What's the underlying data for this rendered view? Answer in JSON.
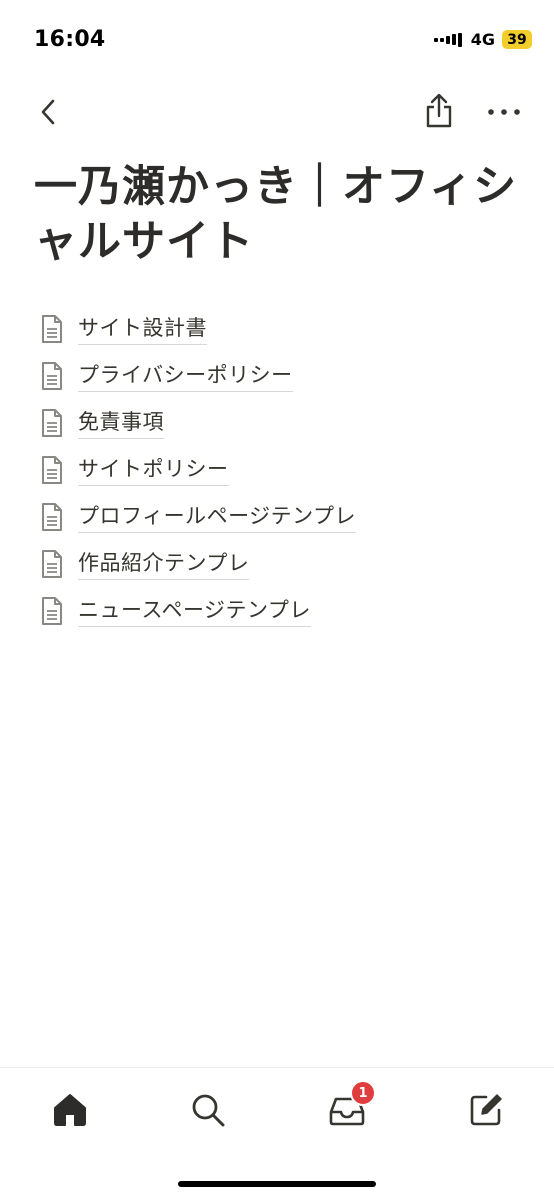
{
  "status_bar": {
    "time": "16:04",
    "network": "4G",
    "battery": "39",
    "battery_color": "#f2cd2b"
  },
  "nav": {
    "back_icon": "chevron-left-icon",
    "share_icon": "share-icon",
    "more_icon": "more-horizontal-icon"
  },
  "page": {
    "title": "一乃瀬かっき｜オフィシャルサイト",
    "items": [
      {
        "label": "サイト設計書",
        "icon": "page-icon"
      },
      {
        "label": "プライバシーポリシー",
        "icon": "page-icon"
      },
      {
        "label": "免責事項",
        "icon": "page-icon"
      },
      {
        "label": "サイトポリシー",
        "icon": "page-icon"
      },
      {
        "label": "プロフィールページテンプレ",
        "icon": "page-icon"
      },
      {
        "label": "作品紹介テンプレ",
        "icon": "page-icon"
      },
      {
        "label": "ニュースページテンプレ",
        "icon": "page-icon"
      }
    ]
  },
  "tab_bar": {
    "tabs": [
      {
        "name": "home",
        "icon": "home-icon"
      },
      {
        "name": "search",
        "icon": "search-icon"
      },
      {
        "name": "inbox",
        "icon": "inbox-icon"
      },
      {
        "name": "compose",
        "icon": "compose-icon"
      }
    ],
    "inbox_badge": "1",
    "badge_color": "#e03e3e"
  }
}
